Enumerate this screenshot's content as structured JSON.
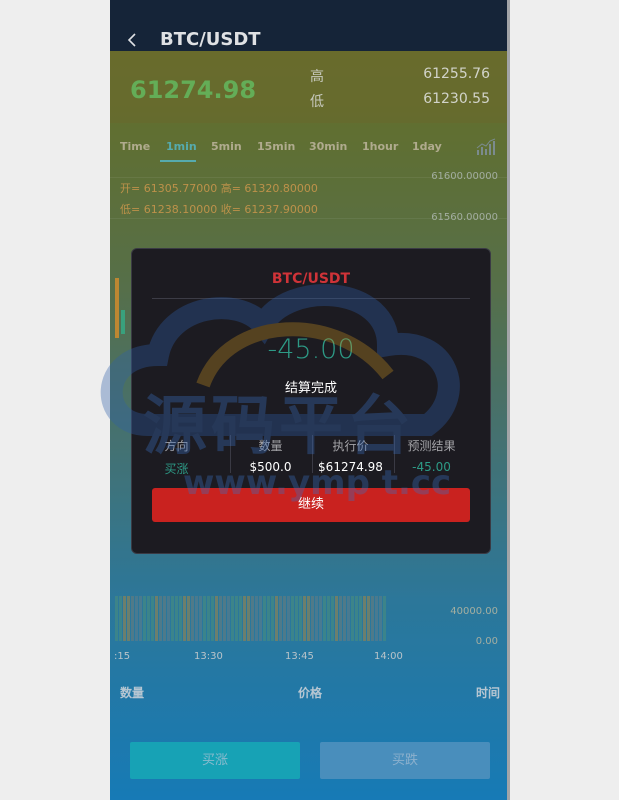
{
  "header": {
    "title": "BTC/USDT"
  },
  "ticker": {
    "last_price": "61274.98",
    "high_label": "高",
    "high_value": "61255.76",
    "low_label": "低",
    "low_value": "61230.55"
  },
  "tabs": [
    {
      "label": "Time"
    },
    {
      "label": "1min"
    },
    {
      "label": "5min"
    },
    {
      "label": "15min"
    },
    {
      "label": "30min"
    },
    {
      "label": "1hour"
    },
    {
      "label": "1day"
    }
  ],
  "ohlc": {
    "line1": "开= 61305.77000  高= 61320.80000",
    "line2": "低= 61238.10000  收= 61237.90000"
  },
  "chart_data": {
    "type": "line",
    "y_ticks": [
      "61600.00000",
      "61560.00000"
    ],
    "volume_ticks": [
      "40000.00",
      "0.00"
    ],
    "x_ticks": [
      ":15",
      "13:30",
      "13:45",
      "14:00"
    ]
  },
  "table": {
    "col_qty": "数量",
    "col_price": "价格",
    "col_time": "时间"
  },
  "actions": {
    "buy_up": "买涨",
    "buy_down": "买跌"
  },
  "modal": {
    "title": "BTC/USDT",
    "result": "-45.00",
    "status": "结算完成",
    "stats": [
      {
        "label": "方向",
        "value": "买涨"
      },
      {
        "label": "数量",
        "value": "$500.0"
      },
      {
        "label": "执行价",
        "value": "$61274.98"
      },
      {
        "label": "预测结果",
        "value": "-45.00"
      }
    ],
    "continue": "继续"
  },
  "watermark": {
    "text_cn": "源码平台",
    "text_url": "www.ymp t.cc"
  },
  "colors": {
    "up": "#2d9a86",
    "down": "#c9221f",
    "accent": "#5ec0c0"
  }
}
